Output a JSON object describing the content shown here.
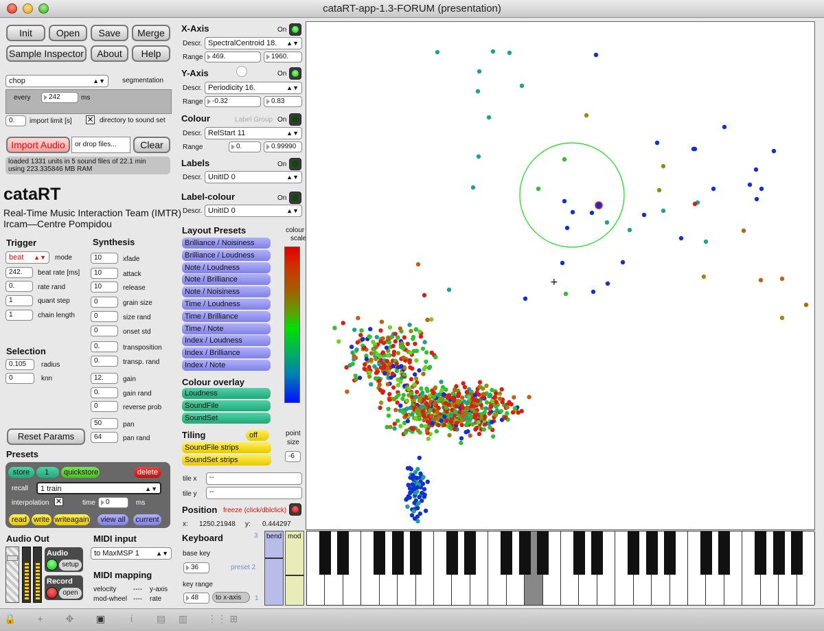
{
  "window": {
    "title": "cataRT-app-1.3-FORUM (presentation)"
  },
  "toolbar": {
    "init": "Init",
    "open": "Open",
    "save": "Save",
    "merge": "Merge",
    "sample_inspector": "Sample Inspector",
    "about": "About",
    "help": "Help"
  },
  "segmentation": {
    "method": "chop",
    "label": "segmentation",
    "every_label": "every",
    "every_value": "242",
    "ms": "ms",
    "import_limit_value": "0.",
    "import_limit_label": "import limit [s]",
    "dir_label": "directory to sound set",
    "dir_checked": "✕"
  },
  "import": {
    "button": "Import Audio",
    "drop": "or drop files...",
    "clear": "Clear",
    "status_line1": "loaded 1331 units in 5 sound files of 22.1 min",
    "status_line2": "using 223.335846 MB RAM"
  },
  "brand": {
    "title": "cataRT",
    "line1": "Real-Time Music Interaction Team (IMTR)",
    "line2": "Ircam—Centre Pompidou"
  },
  "trigger": {
    "title": "Trigger",
    "mode_value": "beat",
    "mode_label": "mode",
    "beat_rate": "242.",
    "beat_rate_label": "beat rate [ms]",
    "rate_rand": "0.",
    "rate_rand_label": "rate rand",
    "quant_step": "1",
    "quant_step_label": "quant step",
    "chain_length": "1",
    "chain_length_label": "chain length"
  },
  "selection": {
    "title": "Selection",
    "radius": "0.105",
    "radius_label": "radius",
    "knn": "0",
    "knn_label": "knn"
  },
  "synthesis": {
    "title": "Synthesis",
    "params": [
      {
        "value": "10",
        "label": "xfade"
      },
      {
        "value": "10",
        "label": "attack"
      },
      {
        "value": "10",
        "label": "release"
      },
      {
        "value": "0",
        "label": "grain size"
      },
      {
        "value": "0",
        "label": "size rand"
      },
      {
        "value": "0",
        "label": "onset std"
      },
      {
        "value": "0.",
        "label": "transposition"
      },
      {
        "value": "0.",
        "label": "transp. rand"
      },
      {
        "value": "12.",
        "label": "gain"
      },
      {
        "value": "0.",
        "label": "gain rand"
      },
      {
        "value": "0",
        "label": "reverse prob"
      },
      {
        "value": "50",
        "label": "pan"
      },
      {
        "value": "64",
        "label": "pan rand"
      }
    ]
  },
  "reset": "Reset Params",
  "presets": {
    "title": "Presets",
    "store": "store",
    "number": "1",
    "quickstore": "quickstore",
    "delete": "delete",
    "recall_label": "recall",
    "recall_value": "1 train",
    "interp_label": "interpolation",
    "interp_checked": "✕",
    "time_label": "time",
    "time_value": "0",
    "time_ms": "ms",
    "read": "read",
    "write": "write",
    "writeagain": "writeagain",
    "view_all": "view all",
    "current": "current"
  },
  "audio": {
    "title": "Audio Out",
    "audio_label": "Audio",
    "setup": "setup",
    "record_label": "Record",
    "open": "open"
  },
  "midi": {
    "title": "MIDI input",
    "device": "to MaxMSP 1",
    "mapping_title": "MIDI mapping",
    "velocity": "velocity",
    "velocity_dash": "----",
    "velocity_target": "y-axis",
    "modwheel": "mod-wheel",
    "modwheel_dash": "----",
    "modwheel_target": "rate"
  },
  "xaxis": {
    "title": "X-Axis",
    "on": "On",
    "descr_label": "Descr.",
    "descr": "SpectralCentroid 18.",
    "range_label": "Range",
    "min": "469.",
    "max": "1960."
  },
  "yaxis": {
    "title": "Y-Axis",
    "on": "On",
    "descr_label": "Descr.",
    "descr": "Periodicity 16.",
    "range_label": "Range",
    "min": "-0.32",
    "max": "0.83"
  },
  "colour": {
    "title": "Colour",
    "label_group": "Label Group",
    "on": "On",
    "descr_label": "Descr.",
    "descr": "RelStart 11",
    "range_label": "Range",
    "min": "0.",
    "max": "0.99990"
  },
  "labels": {
    "title": "Labels",
    "on": "On",
    "descr_label": "Descr.",
    "descr": "UnitID 0"
  },
  "labelcolour": {
    "title": "Label-colour",
    "on": "On",
    "descr_label": "Descr.",
    "descr": "UnitID 0"
  },
  "layout_presets": {
    "title": "Layout Presets",
    "items": [
      "Brilliance / Noisiness",
      "Brilliance / Loudness",
      "Note / Loudness",
      "Note / Brilliance",
      "Note / Noisiness",
      "Time / Loudness",
      "Time / Brilliance",
      "Time / Note",
      "Index / Loudness",
      "Index / Brilliance",
      "Index / Note"
    ]
  },
  "colour_scale": {
    "line1": "colour",
    "line2": "scale"
  },
  "colour_overlay": {
    "title": "Colour overlay",
    "items": [
      "Loudness",
      "SoundFile",
      "SoundSet"
    ]
  },
  "tiling": {
    "title": "Tiling",
    "off": "off",
    "items": [
      "SoundFile strips",
      "SoundSet strips"
    ],
    "point_size_label1": "point",
    "point_size_label2": "size",
    "point_size": "-6",
    "tile_x_label": "tile x",
    "tile_x": "--",
    "tile_y_label": "tile y",
    "tile_y": "--"
  },
  "position": {
    "title": "Position",
    "freeze": "freeze (click/dblclick)",
    "x_label": "x:",
    "x": "1250.21948",
    "y_label": "y:",
    "y": "0.444297"
  },
  "keyboard": {
    "title": "Keyboard",
    "base_key_label": "base key",
    "base_key": "36",
    "key_range_label": "key range",
    "key_range": "48",
    "to_x_axis": "to x-axis",
    "n3": "3",
    "preset2": "preset 2",
    "n1": "1",
    "bend": "bend",
    "mod": "mod"
  },
  "chart_data": {
    "type": "scatter",
    "cursor": [
      1250.21948,
      0.444297
    ],
    "selection_radius": 0.105,
    "colors": {
      "blue": "#1030d0",
      "teal": "#20a090",
      "green": "#30c030",
      "lime": "#70d020",
      "olive": "#909010",
      "red": "#d82010",
      "orange": "#c06010"
    }
  }
}
